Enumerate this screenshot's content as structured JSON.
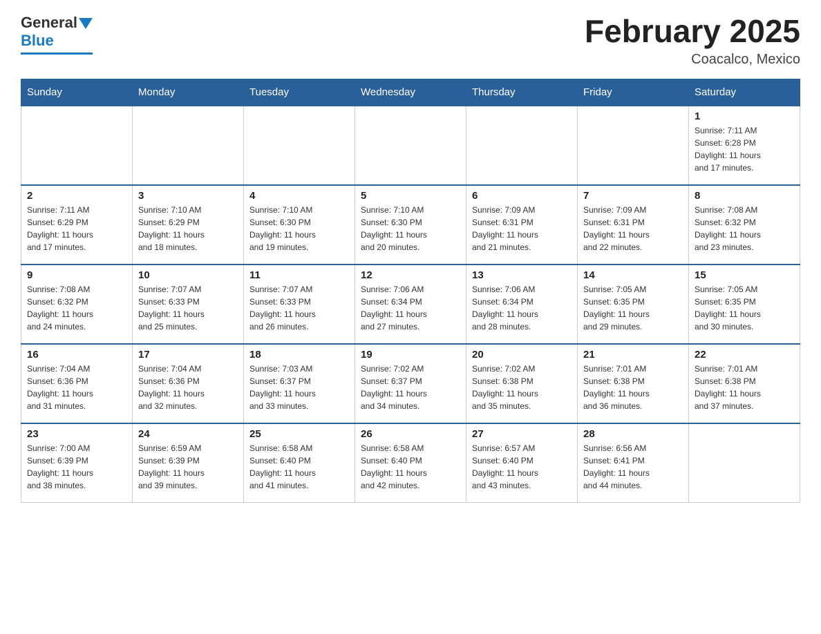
{
  "header": {
    "logo_general": "General",
    "logo_blue": "Blue",
    "title": "February 2025",
    "subtitle": "Coacalco, Mexico"
  },
  "days_of_week": [
    "Sunday",
    "Monday",
    "Tuesday",
    "Wednesday",
    "Thursday",
    "Friday",
    "Saturday"
  ],
  "weeks": [
    {
      "days": [
        {
          "number": "",
          "info": ""
        },
        {
          "number": "",
          "info": ""
        },
        {
          "number": "",
          "info": ""
        },
        {
          "number": "",
          "info": ""
        },
        {
          "number": "",
          "info": ""
        },
        {
          "number": "",
          "info": ""
        },
        {
          "number": "1",
          "info": "Sunrise: 7:11 AM\nSunset: 6:28 PM\nDaylight: 11 hours\nand 17 minutes."
        }
      ]
    },
    {
      "days": [
        {
          "number": "2",
          "info": "Sunrise: 7:11 AM\nSunset: 6:29 PM\nDaylight: 11 hours\nand 17 minutes."
        },
        {
          "number": "3",
          "info": "Sunrise: 7:10 AM\nSunset: 6:29 PM\nDaylight: 11 hours\nand 18 minutes."
        },
        {
          "number": "4",
          "info": "Sunrise: 7:10 AM\nSunset: 6:30 PM\nDaylight: 11 hours\nand 19 minutes."
        },
        {
          "number": "5",
          "info": "Sunrise: 7:10 AM\nSunset: 6:30 PM\nDaylight: 11 hours\nand 20 minutes."
        },
        {
          "number": "6",
          "info": "Sunrise: 7:09 AM\nSunset: 6:31 PM\nDaylight: 11 hours\nand 21 minutes."
        },
        {
          "number": "7",
          "info": "Sunrise: 7:09 AM\nSunset: 6:31 PM\nDaylight: 11 hours\nand 22 minutes."
        },
        {
          "number": "8",
          "info": "Sunrise: 7:08 AM\nSunset: 6:32 PM\nDaylight: 11 hours\nand 23 minutes."
        }
      ]
    },
    {
      "days": [
        {
          "number": "9",
          "info": "Sunrise: 7:08 AM\nSunset: 6:32 PM\nDaylight: 11 hours\nand 24 minutes."
        },
        {
          "number": "10",
          "info": "Sunrise: 7:07 AM\nSunset: 6:33 PM\nDaylight: 11 hours\nand 25 minutes."
        },
        {
          "number": "11",
          "info": "Sunrise: 7:07 AM\nSunset: 6:33 PM\nDaylight: 11 hours\nand 26 minutes."
        },
        {
          "number": "12",
          "info": "Sunrise: 7:06 AM\nSunset: 6:34 PM\nDaylight: 11 hours\nand 27 minutes."
        },
        {
          "number": "13",
          "info": "Sunrise: 7:06 AM\nSunset: 6:34 PM\nDaylight: 11 hours\nand 28 minutes."
        },
        {
          "number": "14",
          "info": "Sunrise: 7:05 AM\nSunset: 6:35 PM\nDaylight: 11 hours\nand 29 minutes."
        },
        {
          "number": "15",
          "info": "Sunrise: 7:05 AM\nSunset: 6:35 PM\nDaylight: 11 hours\nand 30 minutes."
        }
      ]
    },
    {
      "days": [
        {
          "number": "16",
          "info": "Sunrise: 7:04 AM\nSunset: 6:36 PM\nDaylight: 11 hours\nand 31 minutes."
        },
        {
          "number": "17",
          "info": "Sunrise: 7:04 AM\nSunset: 6:36 PM\nDaylight: 11 hours\nand 32 minutes."
        },
        {
          "number": "18",
          "info": "Sunrise: 7:03 AM\nSunset: 6:37 PM\nDaylight: 11 hours\nand 33 minutes."
        },
        {
          "number": "19",
          "info": "Sunrise: 7:02 AM\nSunset: 6:37 PM\nDaylight: 11 hours\nand 34 minutes."
        },
        {
          "number": "20",
          "info": "Sunrise: 7:02 AM\nSunset: 6:38 PM\nDaylight: 11 hours\nand 35 minutes."
        },
        {
          "number": "21",
          "info": "Sunrise: 7:01 AM\nSunset: 6:38 PM\nDaylight: 11 hours\nand 36 minutes."
        },
        {
          "number": "22",
          "info": "Sunrise: 7:01 AM\nSunset: 6:38 PM\nDaylight: 11 hours\nand 37 minutes."
        }
      ]
    },
    {
      "days": [
        {
          "number": "23",
          "info": "Sunrise: 7:00 AM\nSunset: 6:39 PM\nDaylight: 11 hours\nand 38 minutes."
        },
        {
          "number": "24",
          "info": "Sunrise: 6:59 AM\nSunset: 6:39 PM\nDaylight: 11 hours\nand 39 minutes."
        },
        {
          "number": "25",
          "info": "Sunrise: 6:58 AM\nSunset: 6:40 PM\nDaylight: 11 hours\nand 41 minutes."
        },
        {
          "number": "26",
          "info": "Sunrise: 6:58 AM\nSunset: 6:40 PM\nDaylight: 11 hours\nand 42 minutes."
        },
        {
          "number": "27",
          "info": "Sunrise: 6:57 AM\nSunset: 6:40 PM\nDaylight: 11 hours\nand 43 minutes."
        },
        {
          "number": "28",
          "info": "Sunrise: 6:56 AM\nSunset: 6:41 PM\nDaylight: 11 hours\nand 44 minutes."
        },
        {
          "number": "",
          "info": ""
        }
      ]
    }
  ]
}
